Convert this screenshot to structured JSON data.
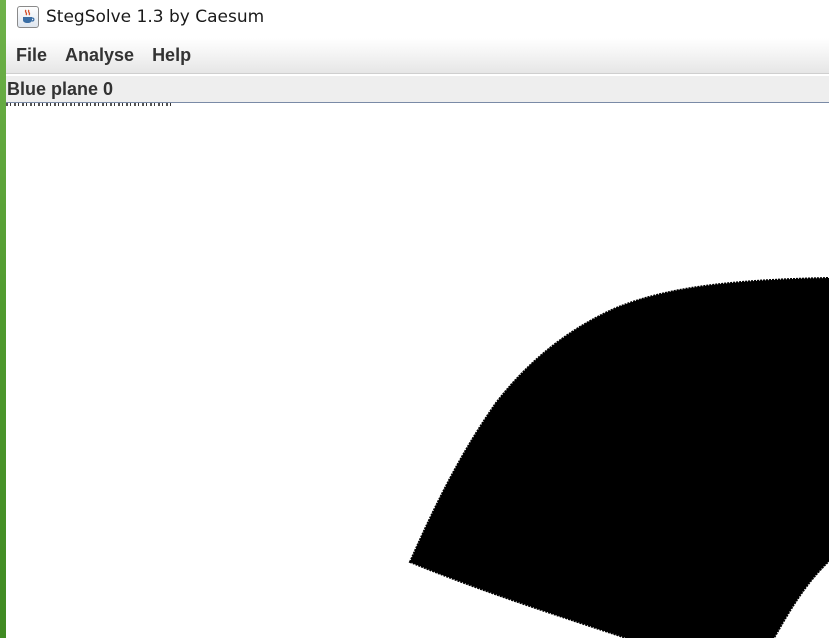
{
  "window": {
    "title": "StegSolve 1.3 by Caesum",
    "icon": "java-cup-icon"
  },
  "menu": {
    "items": [
      {
        "label": "File"
      },
      {
        "label": "Analyse"
      },
      {
        "label": "Help"
      }
    ]
  },
  "viewer": {
    "plane_label": "Blue plane 0"
  },
  "colors": {
    "background": "#ffffff",
    "plane_foreground": "#000000",
    "menubar_text": "#333333",
    "desktop_edge": "#4f9a2e"
  }
}
